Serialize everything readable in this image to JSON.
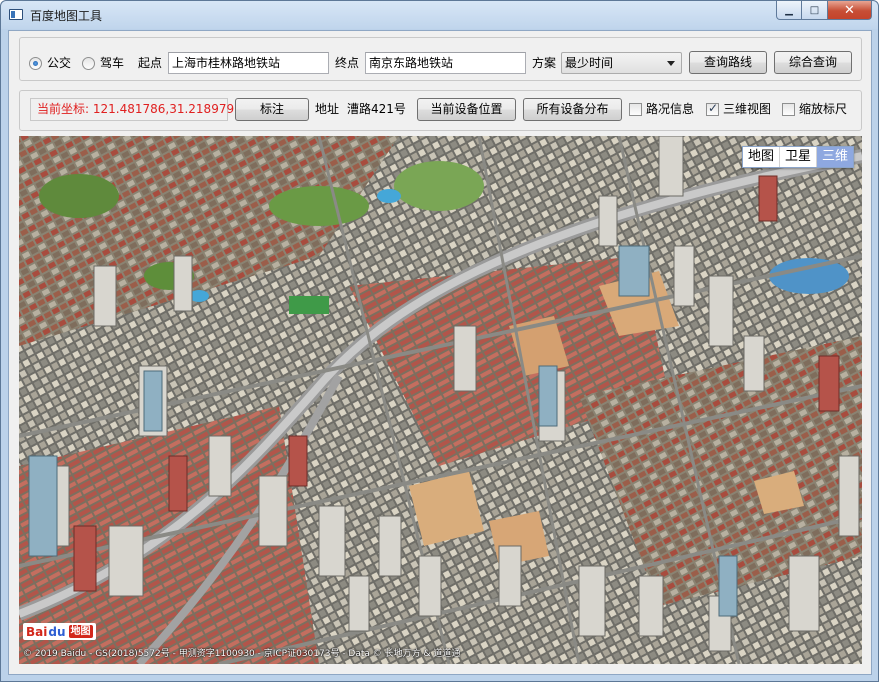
{
  "window": {
    "title": "百度地图工具",
    "min_glyph": "▁",
    "max_glyph": "□",
    "close_glyph": "✕"
  },
  "route_panel": {
    "mode_options": [
      {
        "label": "公交",
        "checked": true
      },
      {
        "label": "驾车",
        "checked": false
      }
    ],
    "start_label": "起点",
    "start_value": "上海市桂林路地铁站",
    "end_label": "终点",
    "end_value": "南京东路地铁站",
    "plan_label": "方案",
    "plan_value": "最少时间",
    "query_route_button": "查询路线",
    "combined_query_button": "综合查询"
  },
  "location_panel": {
    "coordinate_text": "当前坐标: 121.481786,31.218979",
    "mark_button": "标注",
    "address_label": "地址",
    "address_value": "漕路421号",
    "current_device_button": "当前设备位置",
    "all_devices_button": "所有设备分布",
    "checkboxes": [
      {
        "label": "路况信息",
        "checked": false
      },
      {
        "label": "三维视图",
        "checked": true
      },
      {
        "label": "缩放标尺",
        "checked": false
      }
    ]
  },
  "map": {
    "type_buttons": [
      {
        "label": "地图",
        "active": false
      },
      {
        "label": "卫星",
        "active": false
      },
      {
        "label": "三维",
        "active": true
      }
    ],
    "logo_text": "Bai",
    "logo_paw": "du",
    "logo_word": "地图",
    "copyright": "© 2019 Baidu - GS(2018)5572号 - 甲测资字1100930 - 京ICP证030173号 - Data © 长地万方 & 道道通"
  }
}
